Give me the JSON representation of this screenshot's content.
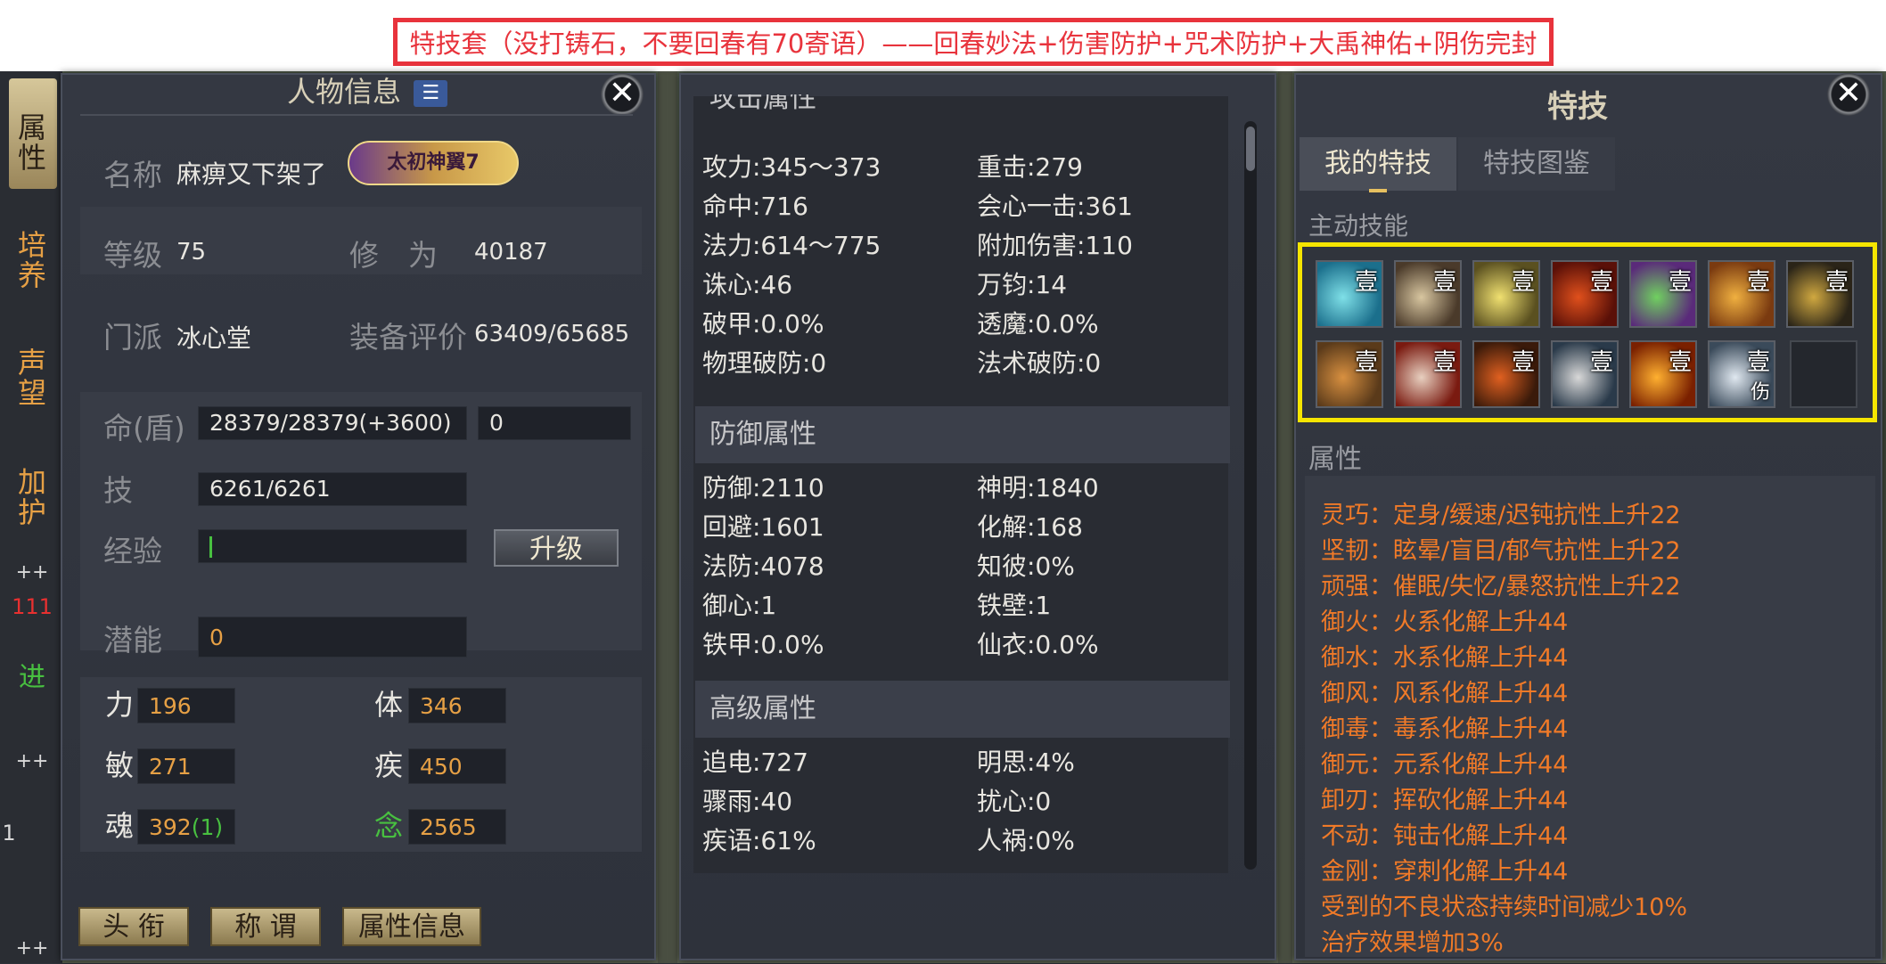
{
  "banner": "特技套（没打铸石，不要回春有70寄语）——回春妙法+伤害防护+咒术防护+大禹神佑+阴伤完封",
  "side_tabs": [
    "属\n性",
    "培\n养",
    "声\n望",
    "加\n护"
  ],
  "side_fragments": {
    "plus1": "++",
    "num": "111",
    "jin": "进",
    "plus2": "++",
    "one": "1",
    "plus3": "++"
  },
  "char_panel": {
    "title": "人物信息",
    "title_icon": "☰",
    "close": "✕",
    "name_label": "名称",
    "name_value": "麻痹又下架了",
    "wing_badge": "太初神翼7",
    "level_label": "等级",
    "level_value": "75",
    "xiuwei_label": "修　为",
    "xiuwei_value": "40187",
    "school_label": "门派",
    "school_value": "冰心堂",
    "equip_label": "装备评价",
    "equip_value": "63409/65685",
    "hp_label": "命(盾)",
    "hp_value": "28379/28379(+3600)",
    "shield_value": "0",
    "skill_label": "技",
    "skill_value": "6261/6261",
    "exp_label": "经验",
    "upgrade_btn": "升级",
    "potential_label": "潜能",
    "potential_value": "0",
    "attrs": [
      {
        "label": "力",
        "value": "196"
      },
      {
        "label": "体",
        "value": "346"
      },
      {
        "label": "敏",
        "value": "271"
      },
      {
        "label": "疾",
        "value": "450"
      },
      {
        "label": "魂",
        "value": "392",
        "extra": "(1)"
      },
      {
        "label": "念",
        "value": "2565"
      }
    ],
    "buttons": [
      "头 衔",
      "称 谓",
      "属性信息"
    ]
  },
  "stats_panel": {
    "partial_header": "攻击属性",
    "attack": [
      [
        "攻力:345～373",
        "重击:279"
      ],
      [
        "命中:716",
        "会心一击:361"
      ],
      [
        "法力:614～775",
        "附加伤害:110"
      ],
      [
        "诛心:46",
        "万钧:14"
      ],
      [
        "破甲:0.0%",
        "透魔:0.0%"
      ],
      [
        "物理破防:0",
        "法术破防:0"
      ]
    ],
    "defense_title": "防御属性",
    "defense": [
      [
        "防御:2110",
        "神明:1840"
      ],
      [
        "回避:1601",
        "化解:168"
      ],
      [
        "法防:4078",
        "知彼:0%"
      ],
      [
        "御心:1",
        "铁壁:1"
      ],
      [
        "铁甲:0.0%",
        "仙衣:0.0%"
      ]
    ],
    "advanced_title": "高级属性",
    "advanced": [
      [
        "追电:727",
        "明思:4%"
      ],
      [
        "骤雨:40",
        "扰心:0"
      ],
      [
        "疾语:61%",
        "人祸:0%"
      ]
    ]
  },
  "skill_panel": {
    "title": "特技",
    "close": "✕",
    "tabs": [
      "我的特技",
      "特技图鉴"
    ],
    "active_label": "主动技能",
    "skills_row1": [
      {
        "num": "壹",
        "icon": "cyan-swirl-icon",
        "c1": "#1b6f8c",
        "c2": "#7fe0e8"
      },
      {
        "num": "壹",
        "icon": "blade-slash-icon",
        "c1": "#4a3a2a",
        "c2": "#d8c6a0"
      },
      {
        "num": "壹",
        "icon": "lightning-burst-icon",
        "c1": "#5a5020",
        "c2": "#f0e070"
      },
      {
        "num": "壹",
        "icon": "fire-demon-icon",
        "c1": "#5a1008",
        "c2": "#e0501c"
      },
      {
        "num": "壹",
        "icon": "rainbow-wave-icon",
        "c1": "#5a2a7a",
        "c2": "#70d060"
      },
      {
        "num": "壹",
        "icon": "golden-fan-icon",
        "c1": "#7a3a10",
        "c2": "#f0b040"
      },
      {
        "num": "壹",
        "icon": "gear-sun-icon",
        "c1": "#2a2418",
        "c2": "#d0a840"
      }
    ],
    "skills_row2": [
      {
        "num": "壹",
        "icon": "armored-warrior-icon",
        "c1": "#5a3a1a",
        "c2": "#d89040"
      },
      {
        "num": "壹",
        "icon": "red-explosion-icon",
        "c1": "#7a1a10",
        "c2": "#e8d0c0"
      },
      {
        "num": "壹",
        "icon": "dark-mage-icon",
        "c1": "#3a1a0a",
        "c2": "#e06020"
      },
      {
        "num": "壹",
        "icon": "scroll-talisman-icon",
        "c1": "#2a3a4a",
        "c2": "#d8d8d8"
      },
      {
        "num": "壹",
        "icon": "flame-strike-icon",
        "c1": "#7a2000",
        "c2": "#ffb030"
      },
      {
        "num": "壹",
        "sub": "伤",
        "icon": "silver-shield-icon",
        "c1": "#3a4a5a",
        "c2": "#e0e8f0"
      }
    ],
    "attr_label": "属性",
    "attributes": [
      "灵巧：定身/缓速/迟钝抗性上升22",
      "坚韧：眩晕/盲目/郁气抗性上升22",
      "顽强：催眠/失忆/暴怒抗性上升22",
      "御火：火系化解上升44",
      "御水：水系化解上升44",
      "御风：风系化解上升44",
      "御毒：毒系化解上升44",
      "御元：元系化解上升44",
      "卸刃：挥砍化解上升44",
      "不动：钝击化解上升44",
      "金刚：穿刺化解上升44",
      "受到的不良状态持续时间减少10%",
      "治疗效果增加3%"
    ],
    "highlight_color": "#f5e500",
    "attr_color": "#f07a28"
  }
}
